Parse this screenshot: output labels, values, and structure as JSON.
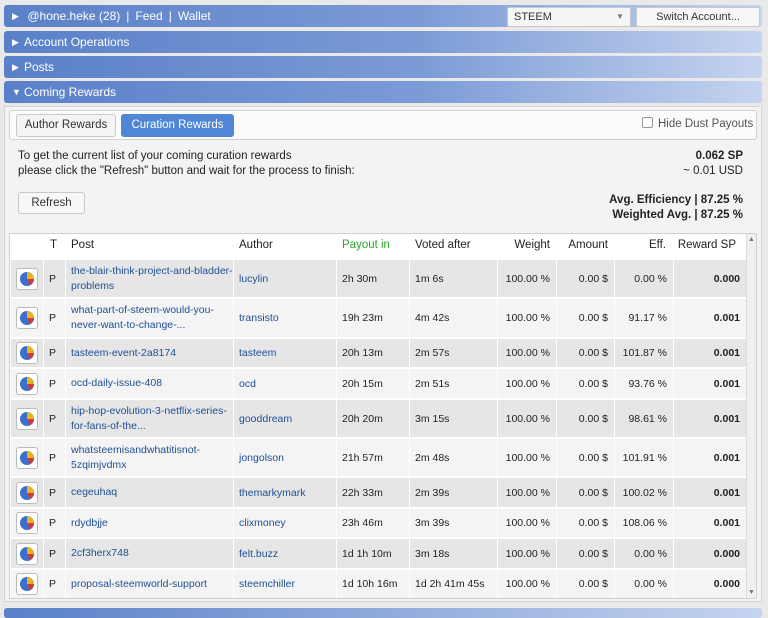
{
  "header": {
    "account": "@hone.heke (28)",
    "feed": "Feed",
    "wallet": "Wallet",
    "separator": "|",
    "currency": "STEEM",
    "switch_label": "Switch Account..."
  },
  "sections": [
    {
      "label": "Account Operations",
      "expanded": false
    },
    {
      "label": "Posts",
      "expanded": false
    },
    {
      "label": "Coming Rewards",
      "expanded": true
    }
  ],
  "tabs": {
    "author": "Author Rewards",
    "curation": "Curation Rewards",
    "active": "Curation Rewards",
    "hide_dust": "Hide Dust Payouts",
    "hide_dust_checked": false
  },
  "info": {
    "line1": "To get the current list of your coming curation rewards",
    "line2": "please click the \"Refresh\" button and wait for the process to finish:",
    "refresh_label": "Refresh"
  },
  "totals": {
    "sp": "0.062 SP",
    "usd": "~ 0.01 USD",
    "avg_efficiency": "Avg. Efficiency | 87.25 %",
    "weighted_avg": "Weighted Avg. | 87.25 %"
  },
  "table": {
    "columns": {
      "t": "T",
      "post": "Post",
      "author": "Author",
      "payout": "Payout in",
      "voted": "Voted after",
      "weight": "Weight",
      "amount": "Amount",
      "eff": "Eff.",
      "reward": "Reward SP"
    },
    "rows": [
      {
        "t": "P",
        "post": "the-blair-think-project-and-bladder-problems",
        "author": "lucylin",
        "payout": "2h 30m",
        "voted": "1m 6s",
        "weight": "100.00 %",
        "amount": "0.00 $",
        "eff": "0.00 %",
        "reward": "0.000"
      },
      {
        "t": "P",
        "post": "what-part-of-steem-would-you-never-want-to-change-...",
        "author": "transisto",
        "payout": "19h 23m",
        "voted": "4m 42s",
        "weight": "100.00 %",
        "amount": "0.00 $",
        "eff": "91.17 %",
        "reward": "0.001"
      },
      {
        "t": "P",
        "post": "tasteem-event-2a8174",
        "author": "tasteem",
        "payout": "20h 13m",
        "voted": "2m 57s",
        "weight": "100.00 %",
        "amount": "0.00 $",
        "eff": "101.87 %",
        "reward": "0.001"
      },
      {
        "t": "P",
        "post": "ocd-daily-issue-408",
        "author": "ocd",
        "payout": "20h 15m",
        "voted": "2m 51s",
        "weight": "100.00 %",
        "amount": "0.00 $",
        "eff": "93.76 %",
        "reward": "0.001"
      },
      {
        "t": "P",
        "post": "hip-hop-evolution-3-netflix-series-for-fans-of-the...",
        "author": "gooddream",
        "payout": "20h 20m",
        "voted": "3m 15s",
        "weight": "100.00 %",
        "amount": "0.00 $",
        "eff": "98.61 %",
        "reward": "0.001"
      },
      {
        "t": "P",
        "post": "whatsteemisandwhatitisnot-5zqimjvdmx",
        "author": "jongolson",
        "payout": "21h 57m",
        "voted": "2m 48s",
        "weight": "100.00 %",
        "amount": "0.00 $",
        "eff": "101.91 %",
        "reward": "0.001"
      },
      {
        "t": "P",
        "post": "cegeuhaq",
        "author": "themarkymark",
        "payout": "22h 33m",
        "voted": "2m 39s",
        "weight": "100.00 %",
        "amount": "0.00 $",
        "eff": "100.02 %",
        "reward": "0.001"
      },
      {
        "t": "P",
        "post": "rdydbjje",
        "author": "clixmoney",
        "payout": "23h 46m",
        "voted": "3m 39s",
        "weight": "100.00 %",
        "amount": "0.00 $",
        "eff": "108.06 %",
        "reward": "0.001"
      },
      {
        "t": "P",
        "post": "2cf3herx748",
        "author": "felt.buzz",
        "payout": "1d 1h 10m",
        "voted": "3m 18s",
        "weight": "100.00 %",
        "amount": "0.00 $",
        "eff": "0.00 %",
        "reward": "0.000"
      },
      {
        "t": "P",
        "post": "proposal-steemworld-support",
        "author": "steemchiller",
        "payout": "1d 10h 16m",
        "voted": "1d 2h 41m 45s",
        "weight": "100.00 %",
        "amount": "0.00 $",
        "eff": "0.00 %",
        "reward": "0.000"
      }
    ]
  },
  "icons": {
    "row_icon": "pie-chart-icon",
    "collapsed": "triangle-right-icon",
    "expanded": "triangle-down-icon",
    "dropdown": "chevron-down-icon"
  },
  "colors": {
    "accent": "#4f86d6",
    "link": "#1f4f94",
    "payout_header": "#2ba82b"
  }
}
